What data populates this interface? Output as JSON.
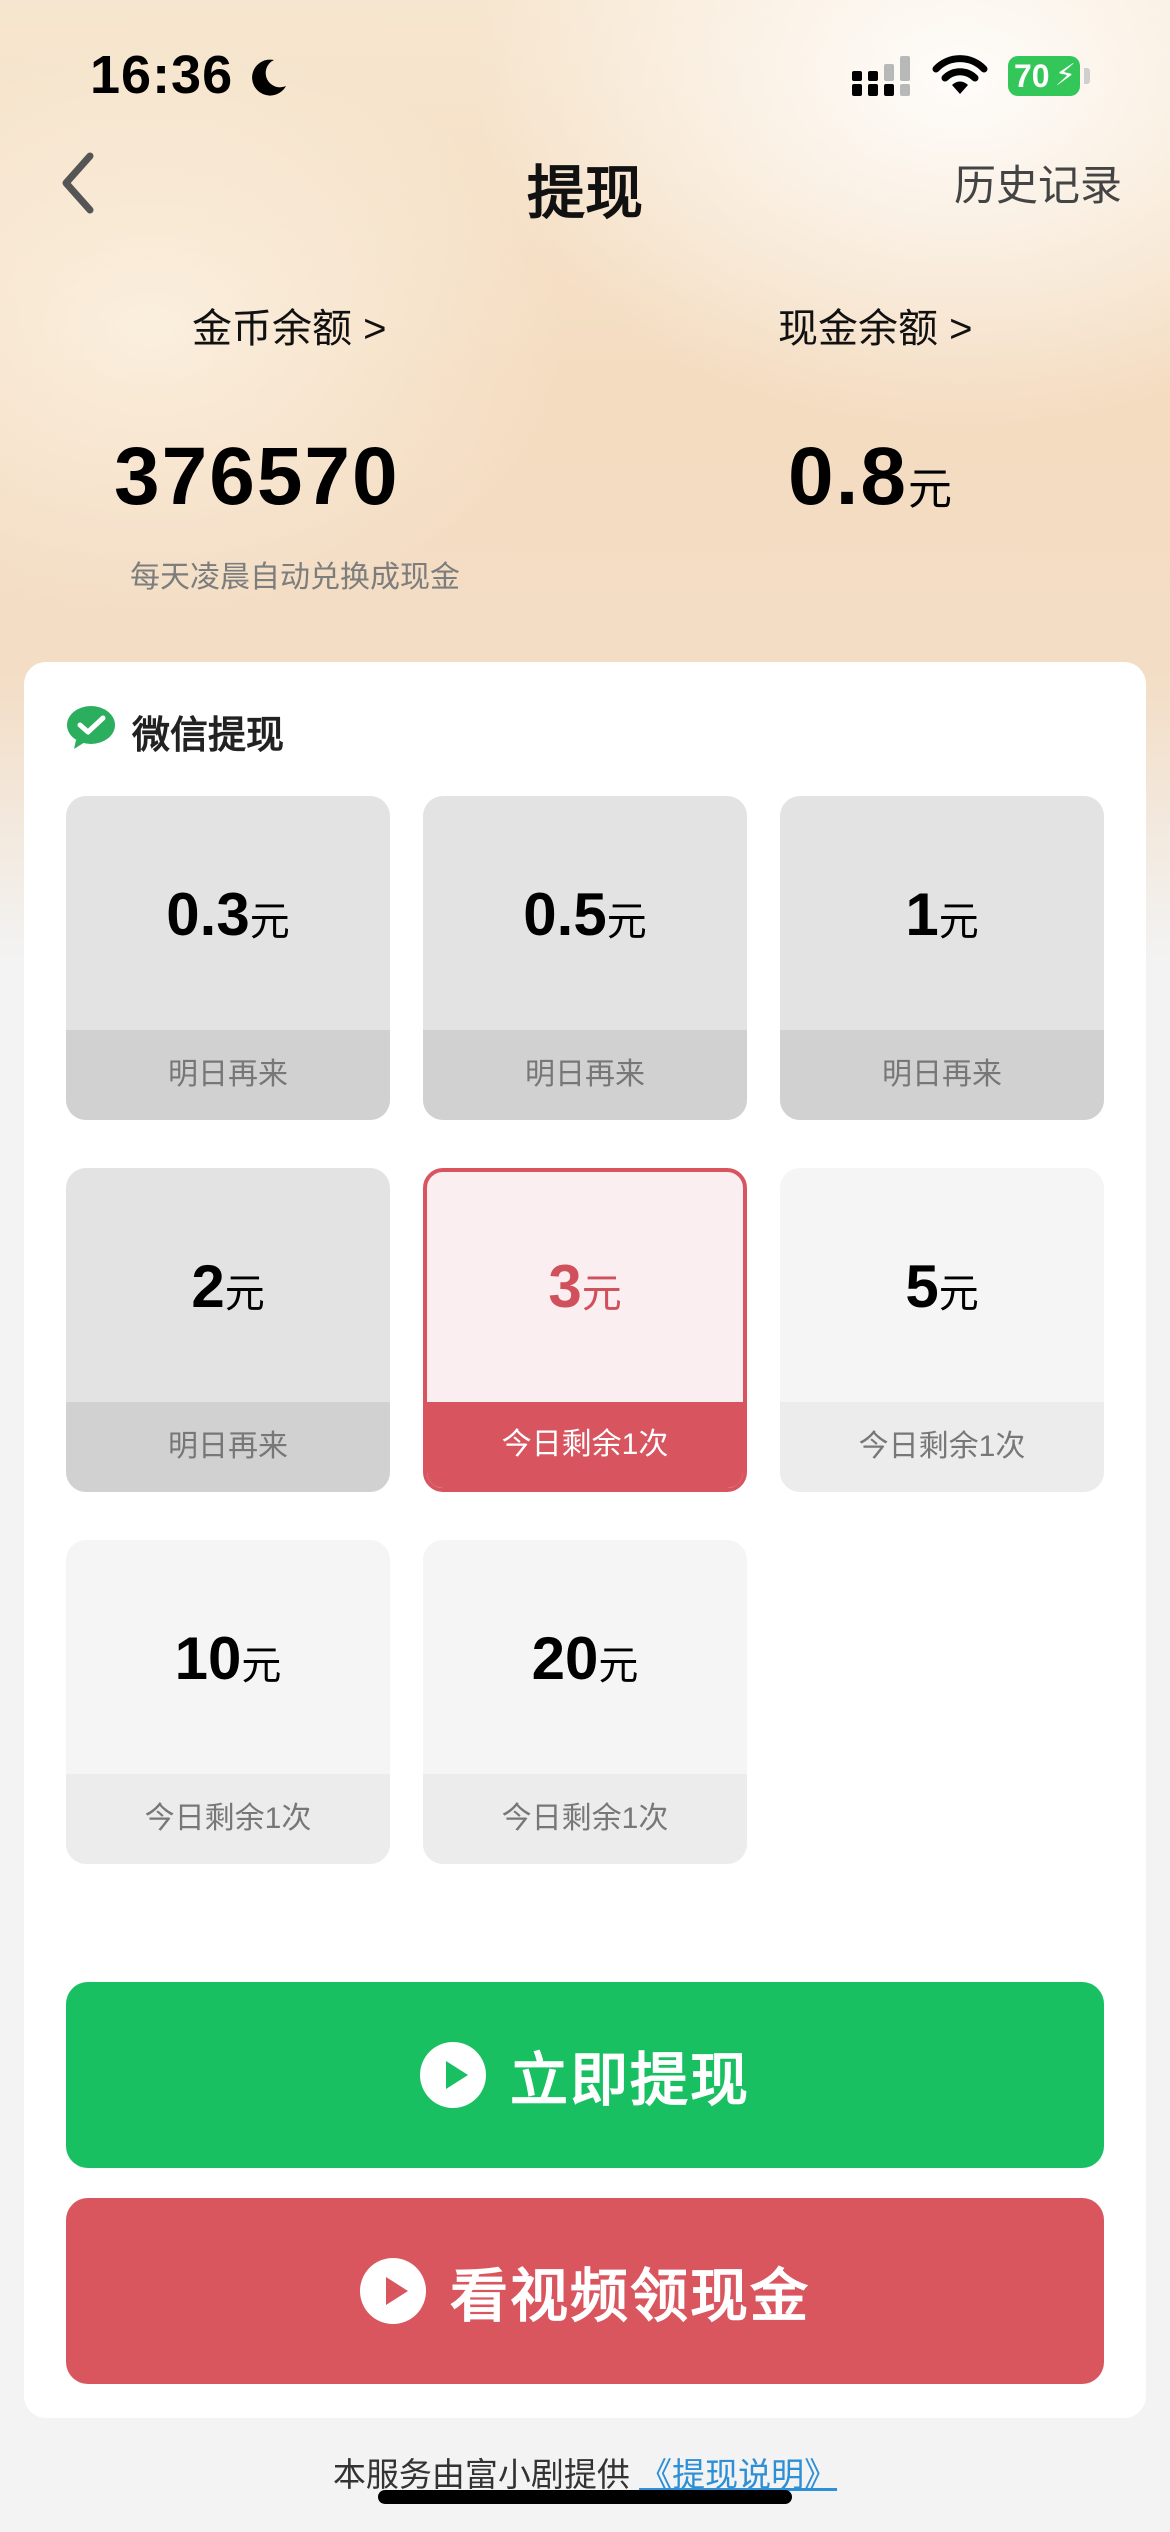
{
  "status_bar": {
    "time": "16:36",
    "battery": "70"
  },
  "nav": {
    "title": "提现",
    "history": "历史记录"
  },
  "balances": {
    "coin_label": "金币余额 >",
    "coin_value": "376570",
    "coin_note": "每天凌晨自动兑换成现金",
    "cash_label": "现金余额 >",
    "cash_value": "0.8",
    "cash_unit": "元"
  },
  "payment": {
    "title": "微信提现"
  },
  "options": [
    {
      "amount": "0.3",
      "unit": "元",
      "status": "明日再来",
      "state": "disabled"
    },
    {
      "amount": "0.5",
      "unit": "元",
      "status": "明日再来",
      "state": "disabled"
    },
    {
      "amount": "1",
      "unit": "元",
      "status": "明日再来",
      "state": "disabled"
    },
    {
      "amount": "2",
      "unit": "元",
      "status": "明日再来",
      "state": "disabled"
    },
    {
      "amount": "3",
      "unit": "元",
      "status": "今日剩余1次",
      "state": "selected"
    },
    {
      "amount": "5",
      "unit": "元",
      "status": "今日剩余1次",
      "state": "available"
    },
    {
      "amount": "10",
      "unit": "元",
      "status": "今日剩余1次",
      "state": "available"
    },
    {
      "amount": "20",
      "unit": "元",
      "status": "今日剩余1次",
      "state": "available"
    }
  ],
  "buttons": {
    "withdraw": "立即提现",
    "watch_video": "看视频领现金"
  },
  "footer": {
    "text": "本服务由富小剧提供",
    "link": "《提现说明》"
  },
  "colors": {
    "green": "#18c062",
    "red": "#d9565f",
    "wechat": "#1aad19"
  },
  "icons": {
    "back": "chevron-left-icon",
    "moon": "moon-icon",
    "signal": "cellular-signal-icon",
    "wifi": "wifi-icon",
    "battery": "battery-charging-icon",
    "wechat": "wechat-icon",
    "play": "play-icon"
  }
}
